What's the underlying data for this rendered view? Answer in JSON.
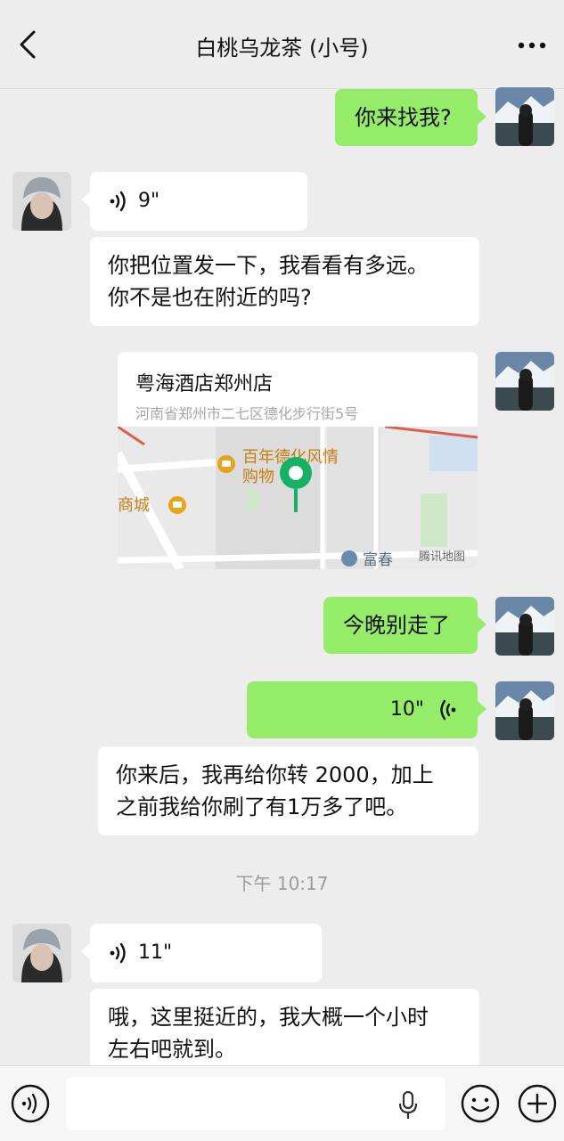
{
  "header": {
    "title": "白桃乌龙茶 (小号)",
    "back_icon": "chevron-left-icon",
    "more_icon": "ellipsis-icon"
  },
  "messages": [
    {
      "from": "me",
      "type": "text",
      "text": "你来找我?"
    },
    {
      "from": "other",
      "type": "voice",
      "duration": "9\""
    },
    {
      "from": "other",
      "type": "text",
      "lines": [
        "你把位置发一下，我看看有多远。",
        "你不是也在附近的吗?"
      ]
    },
    {
      "from": "me",
      "type": "location",
      "name": "粤海酒店郑州店",
      "address": "河南省郑州市二七区德化步行街5号",
      "map_labels": {
        "poi": [
          "百年德化风情",
          "购物"
        ],
        "mall": "商城",
        "building": "富春",
        "provider": "腾讯地图"
      }
    },
    {
      "from": "me",
      "type": "text",
      "text": "今晚别走了"
    },
    {
      "from": "me",
      "type": "voice",
      "duration": "10\""
    },
    {
      "from": "other",
      "type": "text",
      "lines": [
        "你来后，我再给你转 2000，加上",
        "之前我给你刷了有1万多了吧。"
      ]
    },
    {
      "from": "other",
      "type": "voice",
      "duration": "11\""
    },
    {
      "from": "other",
      "type": "text",
      "lines": [
        "哦，这里挺近的，我大概一个小时",
        "左右吧就到。"
      ]
    }
  ],
  "timestamp": "下午 10:17",
  "bottom_bar": {
    "icons": [
      "voice-toggle-icon",
      "microphone-icon",
      "emoji-icon",
      "plus-icon"
    ],
    "input_value": ""
  },
  "colors": {
    "background": "#ededed",
    "my_bubble": "#95ec69",
    "other_bubble": "#ffffff",
    "map_pin": "#15b266",
    "poi": "#e8a317"
  }
}
